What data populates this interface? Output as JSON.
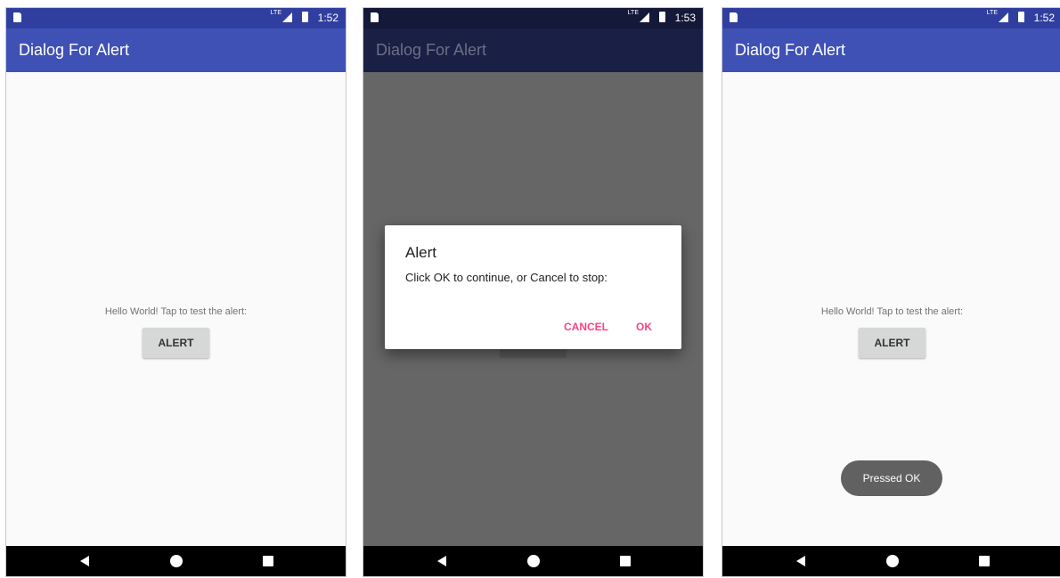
{
  "colors": {
    "primary": "#3f51b5",
    "primary_dark": "#303f9f",
    "accent": "#ff4081",
    "dimmed_appbar": "#1a1f45",
    "dimmed_statusbar": "#141839"
  },
  "screens": [
    {
      "status": {
        "time": "1:52",
        "net": "LTE"
      },
      "app_title": "Dialog For Alert",
      "hello_text": "Hello World! Tap to test the alert:",
      "button_label": "ALERT"
    },
    {
      "status": {
        "time": "1:53",
        "net": "LTE"
      },
      "app_title": "Dialog For Alert",
      "dialog": {
        "title": "Alert",
        "message": "Click OK to continue, or Cancel to stop:",
        "cancel_label": "CANCEL",
        "ok_label": "OK"
      }
    },
    {
      "status": {
        "time": "1:52",
        "net": "LTE"
      },
      "app_title": "Dialog For Alert",
      "hello_text": "Hello World! Tap to test the alert:",
      "button_label": "ALERT",
      "toast": "Pressed OK"
    }
  ],
  "nav_icons": [
    "back-icon",
    "home-icon",
    "recents-icon"
  ]
}
